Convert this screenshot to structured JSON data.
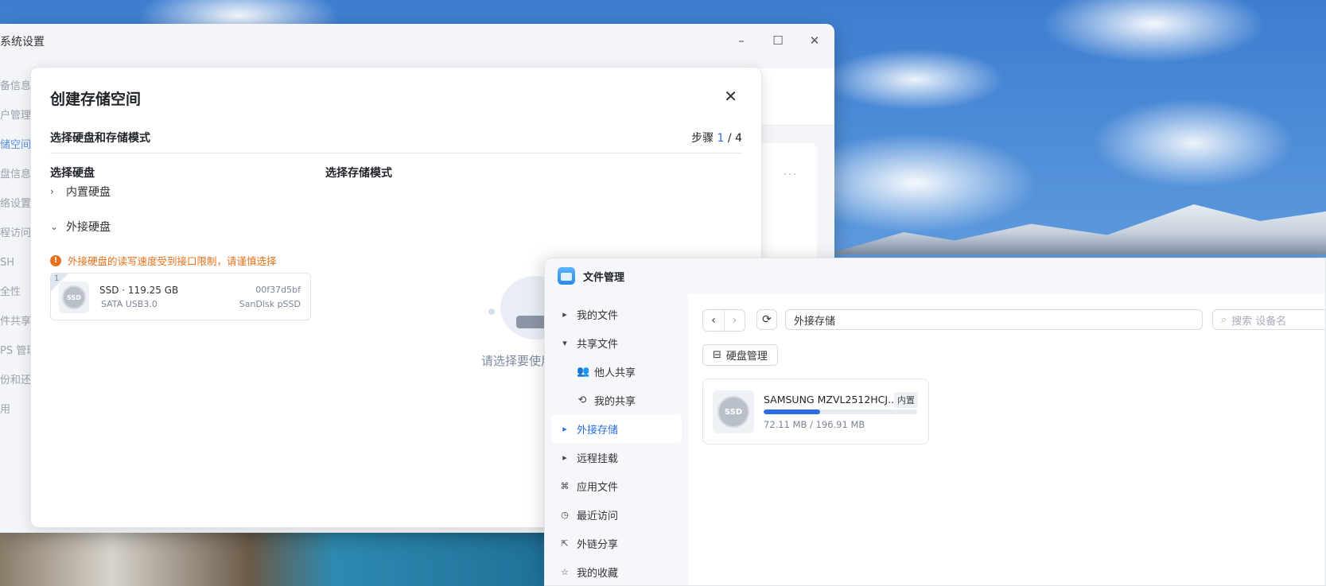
{
  "settings": {
    "title": "系统设置",
    "nav": [
      "备信息",
      "户管理",
      "储空间",
      "盘信息",
      "络设置",
      "程访问",
      "SH",
      "全性",
      "件共享",
      "PS 管理",
      "份和还",
      "用"
    ],
    "active_nav_index": 2,
    "controls": {
      "minimize": "–",
      "maximize": "☐",
      "close": "✕"
    }
  },
  "dialog": {
    "title": "创建存储空间",
    "subtitle": "选择硬盘和存储模式",
    "step_label": "步骤",
    "step_current": "1",
    "step_total": "/ 4",
    "col_disks": "选择硬盘",
    "col_mode": "选择存储模式",
    "group_internal": "内置硬盘",
    "group_external": "外接硬盘",
    "warning": "外接硬盘的读写速度受到接口限制，请谨慎选择",
    "disk": {
      "index": "1",
      "icon_text": "SSD",
      "name": "SSD · 119.25 GB",
      "interface": "SATA USB3.0",
      "serial": "00f37d5bf",
      "model": "SanDisk pSSD"
    },
    "empty_text": "请选择要使用"
  },
  "file_manager": {
    "title": "文件管理",
    "nav": [
      {
        "label": "我的文件",
        "icon": "▸",
        "sub": false
      },
      {
        "label": "共享文件",
        "icon": "▾",
        "sub": false
      },
      {
        "label": "他人共享",
        "icon": "👥",
        "sub": true
      },
      {
        "label": "我的共享",
        "icon": "⟲",
        "sub": true
      },
      {
        "label": "外接存储",
        "icon": "▸",
        "sub": false,
        "active": true
      },
      {
        "label": "远程挂载",
        "icon": "▸",
        "sub": false
      },
      {
        "label": "应用文件",
        "icon": "⌘",
        "sub": false
      },
      {
        "label": "最近访问",
        "icon": "◷",
        "sub": false
      },
      {
        "label": "外链分享",
        "icon": "⇱",
        "sub": false
      },
      {
        "label": "我的收藏",
        "icon": "☆",
        "sub": false
      }
    ],
    "path": "外接存储",
    "search_placeholder": "搜索 设备名",
    "disk_mgmt_label": "硬盘管理",
    "device": {
      "icon_text": "SSD",
      "name": "SAMSUNG MZVL2512HCJ...",
      "tag": "内置",
      "usage": "72.11 MB / 196.91 MB",
      "used_fraction": 0.37
    }
  },
  "colors": {
    "accent": "#2b6de0",
    "warning": "#e8701a"
  }
}
